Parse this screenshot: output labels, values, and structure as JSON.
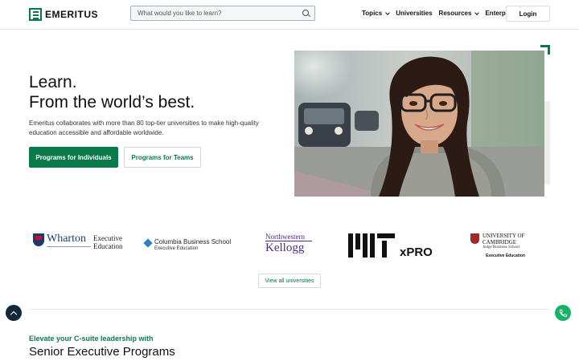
{
  "brand": {
    "name": "EMERITUS",
    "accent": "#0b7a4b"
  },
  "header": {
    "search_placeholder": "What would you like to learn?",
    "nav": [
      {
        "label": "Topics",
        "has_dropdown": true
      },
      {
        "label": "Universities",
        "has_dropdown": false
      },
      {
        "label": "Resources",
        "has_dropdown": true
      },
      {
        "label": "Enterprise",
        "has_dropdown": true
      }
    ],
    "login_label": "Login"
  },
  "hero": {
    "title_line1": "Learn.",
    "title_line2": "From the world’s best.",
    "description": "Emeritus collaborates with more than 80 top-tier universities to make high-quality education accessible and affordable worldwide.",
    "primary_button": "Programs for Individuals",
    "secondary_button": "Programs for Teams"
  },
  "universities": {
    "wharton": {
      "name": "Wharton",
      "sub": "Executive Education"
    },
    "columbia": {
      "name": "Columbia Business School",
      "sub": "Executive Education"
    },
    "kellogg": {
      "top": "Northwestern",
      "name": "Kellogg"
    },
    "mit": {
      "name": "xPRO"
    },
    "cambridge": {
      "name1": "UNIVERSITY OF",
      "name2": "CAMBRIDGE",
      "sub": "Judge Business School",
      "exec": "Executive Education"
    },
    "view_all_label": "View all universities"
  },
  "section": {
    "eyebrow": "Elevate your C-suite leadership with",
    "title": "Senior Executive Programs"
  }
}
